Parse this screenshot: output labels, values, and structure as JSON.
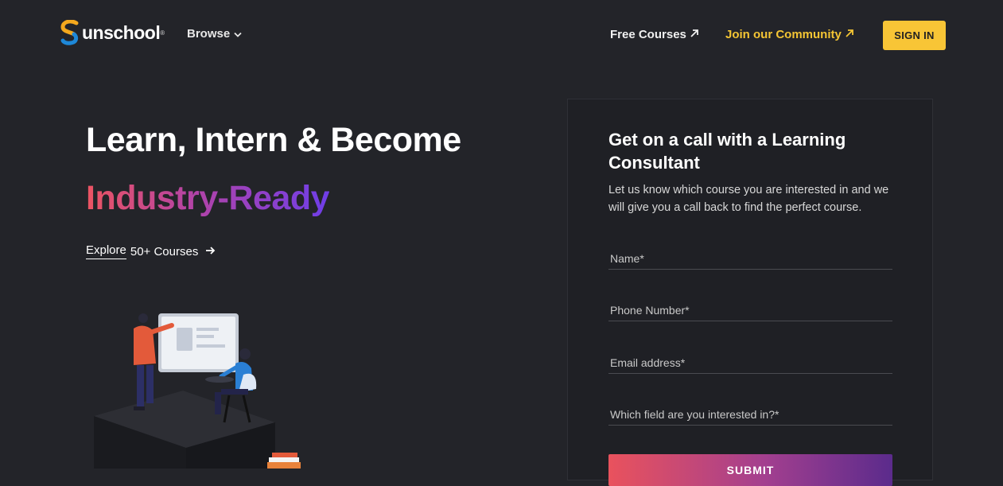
{
  "header": {
    "logo_text": "unschool",
    "logo_reg": "®",
    "browse_label": "Browse",
    "free_courses_label": "Free Courses",
    "community_label": "Join our Community",
    "signin_label": "SIGN IN"
  },
  "hero": {
    "line1": "Learn, Intern & Become",
    "line2": "Industry-Ready",
    "explore_underlined": "Explore",
    "explore_rest": " 50+ Courses"
  },
  "form": {
    "title": "Get on a call with a Learning Consultant",
    "subtitle": "Let us know which course you are interested in and we will give you a call back to find the perfect course.",
    "name_placeholder": "Name*",
    "phone_placeholder": "Phone Number*",
    "email_placeholder": "Email address*",
    "field_placeholder": "Which field are you interested in?*",
    "submit_label": "SUBMIT"
  },
  "colors": {
    "background": "#232429",
    "accent_yellow": "#f8c536",
    "gradient_start": "#ec5462",
    "gradient_end": "#6f3ee8"
  },
  "icons": [
    "unschool-logo-icon",
    "chevron-down-icon",
    "arrow-up-right-icon",
    "arrow-right-icon"
  ]
}
